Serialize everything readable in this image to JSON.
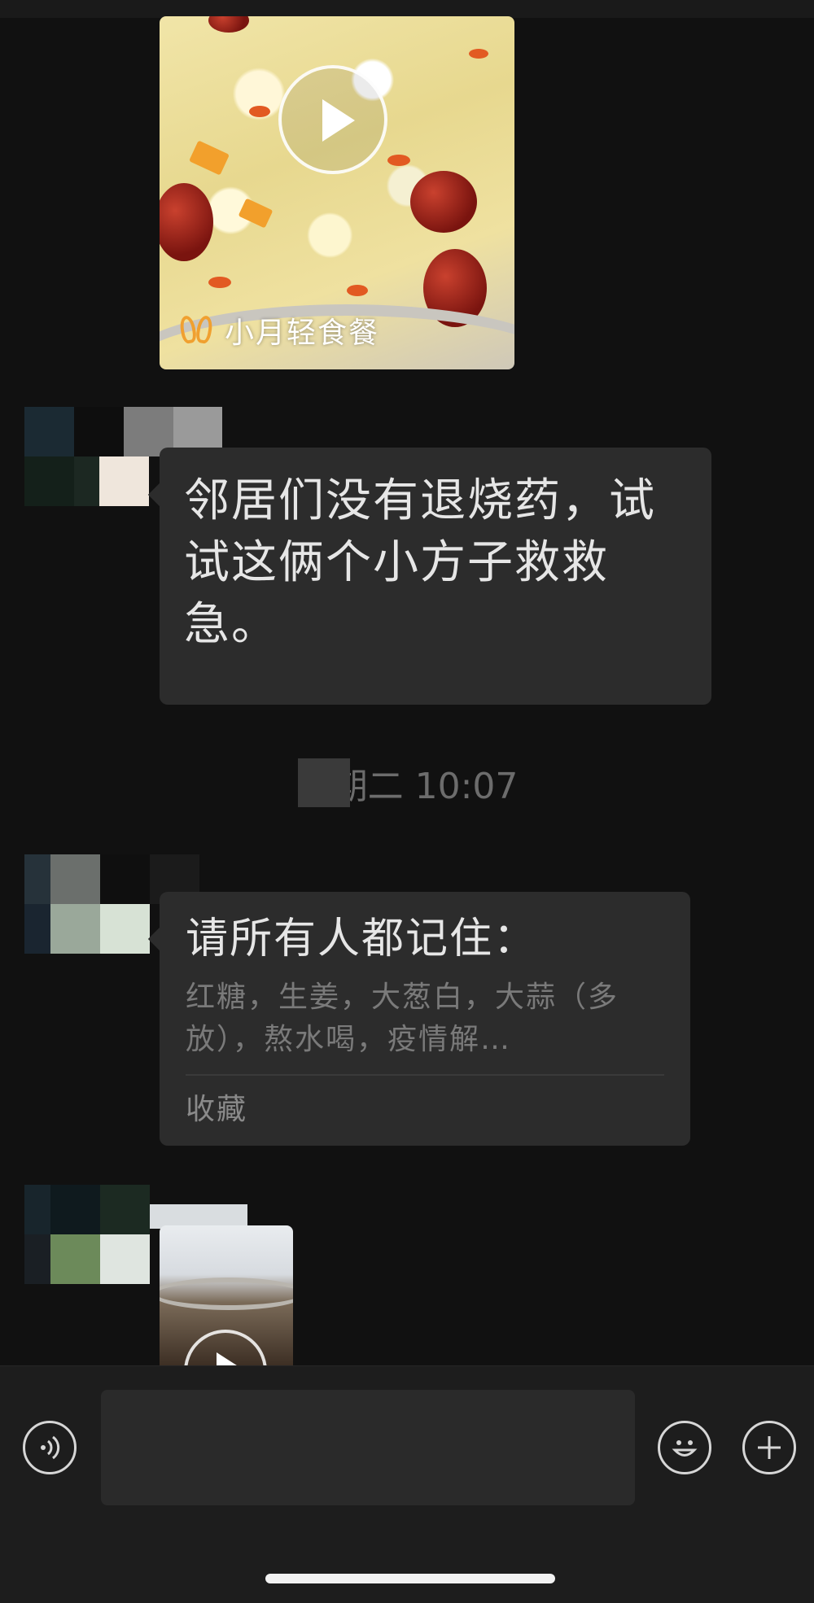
{
  "chat": {
    "messages": [
      {
        "type": "video",
        "watermark": "小月轻食餐"
      },
      {
        "type": "text",
        "text": "邻居们没有退烧药，试试这俩个小方子救救急。"
      },
      {
        "type": "timestamp",
        "text": "星期二 10:07"
      },
      {
        "type": "note",
        "title": "请所有人都记住：",
        "snippet": "红糖，生姜，大葱白，大蒜（多放），熬水喝，疫情解…",
        "source": "收藏"
      },
      {
        "type": "video",
        "watermark": ""
      }
    ]
  },
  "input_bar": {
    "voice_icon": "voice-icon",
    "emoji_icon": "emoji-icon",
    "plus_icon": "plus-icon",
    "text": ""
  },
  "colors": {
    "background": "#111111",
    "bubble": "#2c2c2c",
    "input_bar": "#1d1d1d"
  }
}
